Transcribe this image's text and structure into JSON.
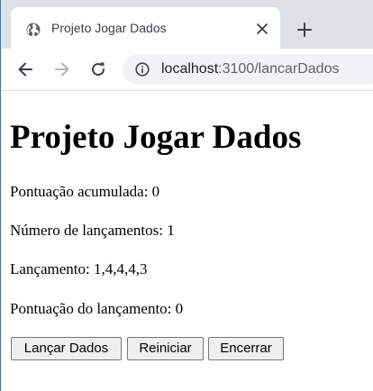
{
  "browser": {
    "tab": {
      "title": "Projeto Jogar Dados",
      "favicon": "globe-icon",
      "close_icon": "close-icon"
    },
    "new_tab_icon": "plus-icon",
    "toolbar": {
      "back_icon": "back-arrow-icon",
      "forward_icon": "forward-arrow-icon",
      "reload_icon": "reload-icon",
      "info_icon": "info-icon"
    },
    "address_bar": {
      "host": "localhost",
      "rest": ":3100/lancarDados"
    }
  },
  "page": {
    "title": "Projeto Jogar Dados",
    "lines": {
      "pontuacao_acumulada": "Pontuação acumulada: 0",
      "numero_lancamentos": "Número de lançamentos: 1",
      "lancamento": "Lançamento: 1,4,4,4,3",
      "pontuacao_lancamento": "Pontuação do lançamento: 0"
    },
    "buttons": {
      "lancar": "Lançar Dados",
      "reiniciar": "Reiniciar",
      "encerrar": "Encerrar"
    }
  },
  "colors": {
    "tabstrip_bg": "#dee1e6",
    "omnibox_bg": "#f1f3f4",
    "window_border": "#2b78d8",
    "button_bg": "#efefef",
    "button_border": "#767676"
  }
}
